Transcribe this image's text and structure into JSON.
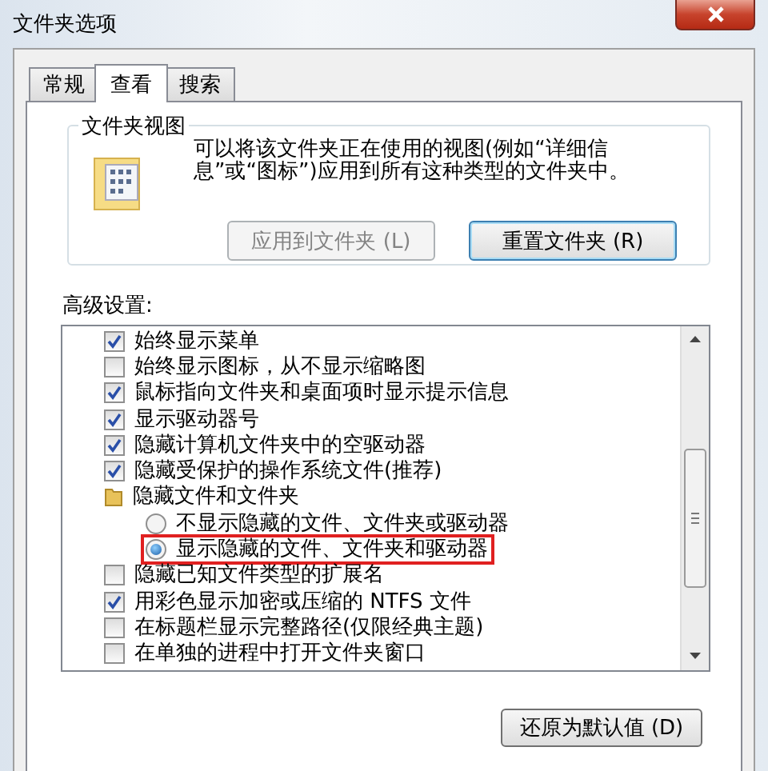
{
  "window": {
    "title": "文件夹选项"
  },
  "tabs": [
    {
      "label": "常规",
      "selected": false
    },
    {
      "label": "查看",
      "selected": true
    },
    {
      "label": "搜索",
      "selected": false
    }
  ],
  "folder_views": {
    "title": "文件夹视图",
    "description": "可以将该文件夹正在使用的视图(例如“详细信息”或“图标”)应用到所有这种类型的文件夹中。",
    "buttons": [
      {
        "label": "应用到文件夹 (L)",
        "disabled": true
      },
      {
        "label": "重置文件夹 (R)",
        "disabled": false
      }
    ]
  },
  "advanced": {
    "label": "高级设置:",
    "items": [
      {
        "kind": "checkbox",
        "label": "始终显示菜单",
        "checked": true
      },
      {
        "kind": "checkbox",
        "label": "始终显示图标，从不显示缩略图",
        "checked": false
      },
      {
        "kind": "checkbox",
        "label": "鼠标指向文件夹和桌面项时显示提示信息",
        "checked": true
      },
      {
        "kind": "checkbox",
        "label": "显示驱动器号",
        "checked": true
      },
      {
        "kind": "checkbox",
        "label": "隐藏计算机文件夹中的空驱动器",
        "checked": true
      },
      {
        "kind": "checkbox",
        "label": "隐藏受保护的操作系统文件(推荐)",
        "checked": true
      },
      {
        "kind": "folder",
        "label": "隐藏文件和文件夹"
      },
      {
        "kind": "radio",
        "label": "不显示隐藏的文件、文件夹或驱动器",
        "selected": false,
        "highlighted": false
      },
      {
        "kind": "radio",
        "label": "显示隐藏的文件、文件夹和驱动器",
        "selected": true,
        "highlighted": true
      },
      {
        "kind": "checkbox",
        "label": "隐藏已知文件类型的扩展名",
        "checked": false
      },
      {
        "kind": "checkbox",
        "label": "用彩色显示加密或压缩的 NTFS 文件",
        "checked": true
      },
      {
        "kind": "checkbox",
        "label": "在标题栏显示完整路径(仅限经典主题)",
        "checked": false
      },
      {
        "kind": "checkbox",
        "label": "在单独的进程中打开文件夹窗口",
        "checked": false
      }
    ],
    "restore_button": "还原为默认值 (D)"
  }
}
